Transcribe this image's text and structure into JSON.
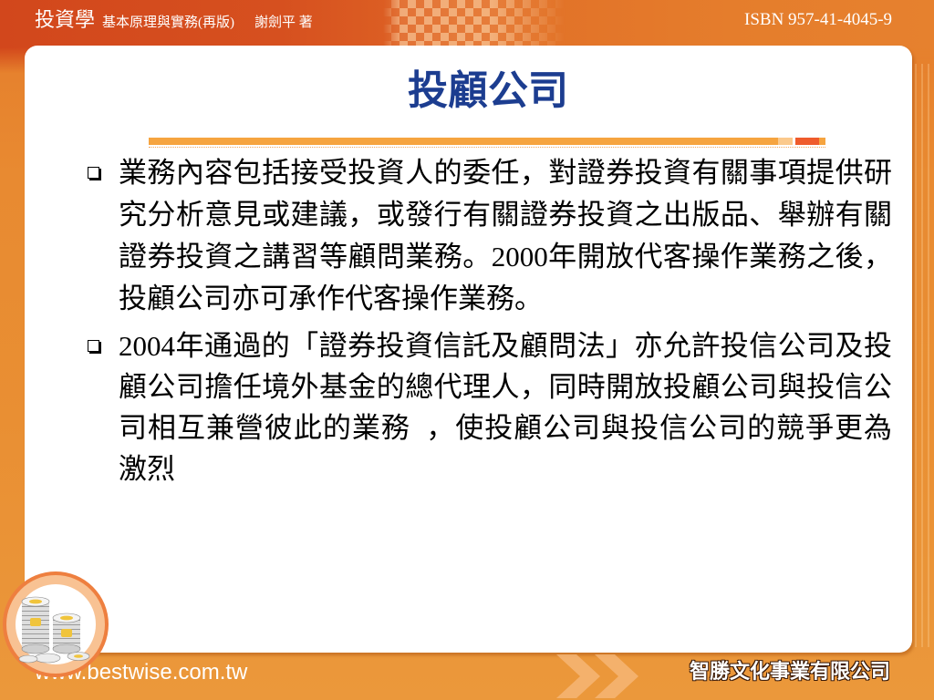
{
  "header": {
    "book_title": "投資學",
    "book_subtitle": "基本原理與實務(再版)",
    "author": "謝劍平 著",
    "isbn": "ISBN 957-41-4045-9"
  },
  "slide": {
    "title": "投顧公司",
    "bullets": [
      {
        "lines": [
          "業務內容包括接受投資人的委任，對證券投資有關事項提供研",
          "究分析意見或建議，或發行有關證券投資之出版品、舉辦有關",
          "證券投資之講習等顧問業務。2000年開放代客操作業務之後，",
          "投顧公司亦可承作代客操作業務。"
        ]
      },
      {
        "lines": [
          "2004年通過的「證券投資信託及顧問法」亦允許投信公司及投",
          "顧公司擔任境外基金的總代理人，同時開放投顧公司與投信公",
          "司相互兼營彼此的業務  ，使投顧公司與投信公司的競爭更為",
          "激烈"
        ]
      }
    ]
  },
  "footer": {
    "website": "www.bestwise.com.tw",
    "publisher": "智勝文化事業有限公司"
  },
  "icons": {
    "bullet": "hollow-square-bullet",
    "corner_decoration": "coin-stack",
    "footer_decoration": "double-chevron-right"
  },
  "colors": {
    "frame": "#e98f33",
    "header": "#d2471c",
    "title": "#1c3d90",
    "divider": "#f6a43f",
    "divider_accent": "#ef5b2b",
    "body_text": "#000000",
    "panel": "#ffffff"
  }
}
